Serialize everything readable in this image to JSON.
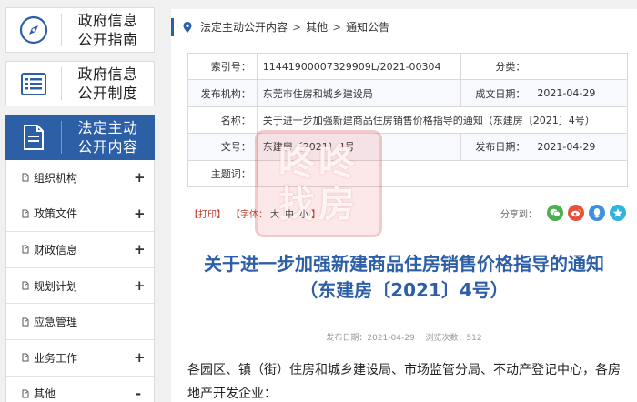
{
  "sidebar": {
    "tiles": [
      {
        "label": "政府信息\n公开指南",
        "icon": "compass-icon"
      },
      {
        "label": "政府信息\n公开制度",
        "icon": "list-icon"
      },
      {
        "label": "法定主动\n公开内容",
        "icon": "document-icon"
      }
    ],
    "items": [
      {
        "label": "组织机构",
        "toggle": "+"
      },
      {
        "label": "政策文件",
        "toggle": "+"
      },
      {
        "label": "财政信息",
        "toggle": "+"
      },
      {
        "label": "规划计划",
        "toggle": "+"
      },
      {
        "label": "应急管理",
        "toggle": ""
      },
      {
        "label": "业务工作",
        "toggle": "+"
      },
      {
        "label": "其他",
        "toggle": "-"
      }
    ]
  },
  "breadcrumb": {
    "items": [
      "法定主动公开内容",
      "其他",
      "通知公告"
    ],
    "sep": ">"
  },
  "meta": {
    "index_label": "索引号：",
    "index_value": "11441900007329909L/2021-00304",
    "category_label": "分类：",
    "category_value": "",
    "publisher_label": "发布机构：",
    "publisher_value": "东莞市住房和城乡建设局",
    "created_label": "成文日期：",
    "created_value": "2021-04-29",
    "name_label": "名称：",
    "name_value": "关于进一步加强新建商品住房销售价格指导的通知（东建房〔2021〕4号）",
    "docno_label": "文号：",
    "docno_value": "东建房〔2021〕4号",
    "pubdate_label": "发布日期：",
    "pubdate_value": "2021-04-29",
    "keywords_label": "主题词：",
    "keywords_value": ""
  },
  "watermark": {
    "line1": "咚咚",
    "line2": "找房"
  },
  "toolbar": {
    "print": "【打印】",
    "font_prefix": "【字体：",
    "font_large": "大",
    "font_medium": "中",
    "font_small": "小",
    "font_suffix": "】",
    "share_label": "分享到："
  },
  "article": {
    "title_line1": "关于进一步加强新建商品住房销售价格指导的通知",
    "title_line2": "（东建房〔2021〕4号）",
    "pub_label": "发布日期：",
    "pub_date": "2021-04-29",
    "views_label": "浏览次数：",
    "views": "512",
    "body": "各园区、镇（街）住房和城乡建设局、市场监管分局、不动产登记中心，各房地产开发企业："
  },
  "colors": {
    "brand": "#2d5fa6",
    "accent_red": "#c0392b"
  }
}
